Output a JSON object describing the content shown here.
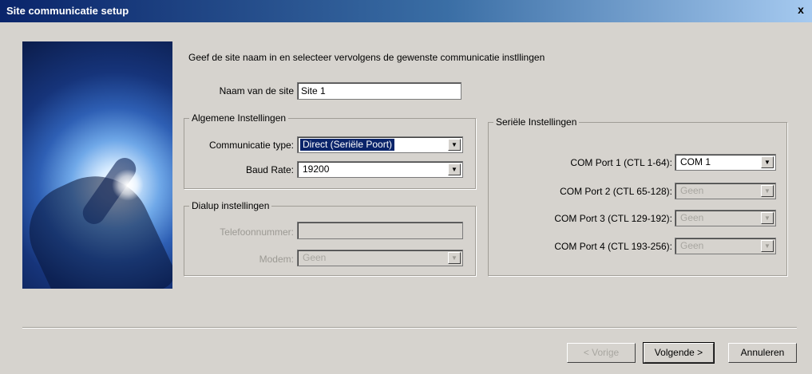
{
  "window": {
    "title": "Site communicatie setup",
    "close_label": "x"
  },
  "instruction": "Geef de site naam in en selecteer vervolgens de gewenste communicatie instllingen",
  "site_name": {
    "label": "Naam van de site",
    "value": "Site 1"
  },
  "general": {
    "title": "Algemene Instellingen",
    "comm_type_label": "Communicatie type:",
    "comm_type_value": "Direct (Seriële Poort)",
    "baud_label": "Baud Rate:",
    "baud_value": "19200"
  },
  "dialup": {
    "title": "Dialup instellingen",
    "phone_label": "Telefoonnummer:",
    "phone_value": "",
    "modem_label": "Modem:",
    "modem_value": "Geen"
  },
  "serial": {
    "title": "Seriële Instellingen",
    "ports": [
      {
        "label": "COM Port 1 (CTL 1-64):",
        "value": "COM 1"
      },
      {
        "label": "COM Port 2 (CTL 65-128):",
        "value": "Geen"
      },
      {
        "label": "COM Port 3 (CTL 129-192):",
        "value": "Geen"
      },
      {
        "label": "COM Port 4 (CTL 193-256):",
        "value": "Geen"
      }
    ]
  },
  "buttons": {
    "back": "< Vorige",
    "next": "Volgende >",
    "cancel": "Annuleren"
  },
  "icons": {
    "hero": "hand-touching-light-illustration",
    "dropdown": "chevron-down-icon",
    "close": "close-icon"
  },
  "colors": {
    "titlebar": "#0a246a",
    "selection": "#0a246a",
    "window": "#d6d3ce"
  }
}
